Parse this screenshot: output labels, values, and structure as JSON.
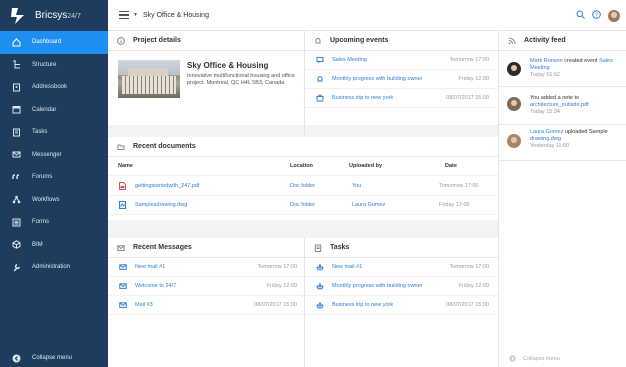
{
  "app": {
    "name": "Bricsys",
    "version": "24/7"
  },
  "breadcrumb": "Sky Office & Housing",
  "sidebar": {
    "items": [
      {
        "label": "Dashboard",
        "icon": "home-icon"
      },
      {
        "label": "Structure",
        "icon": "structure-icon"
      },
      {
        "label": "Addressbook",
        "icon": "addressbook-icon"
      },
      {
        "label": "Calendar",
        "icon": "calendar-icon"
      },
      {
        "label": "Tasks",
        "icon": "tasks-icon"
      },
      {
        "label": "Messenger",
        "icon": "envelope-icon"
      },
      {
        "label": "Forums",
        "icon": "quote-icon"
      },
      {
        "label": "Workflows",
        "icon": "workflow-icon"
      },
      {
        "label": "Forms",
        "icon": "forms-icon"
      },
      {
        "label": "BIM",
        "icon": "bim-icon"
      },
      {
        "label": "Administration",
        "icon": "wrench-icon"
      }
    ],
    "collapse": "Collapse menu"
  },
  "project": {
    "title": "Project details",
    "name": "Sky Office & Housing",
    "description": "Innovative multifunctional housing and office project. Montreal, QC H4L 5B3, Canada"
  },
  "events": {
    "title": "Upcoming events",
    "rows": [
      {
        "label": "Sales Meeting",
        "time": "Tomorrow 17:00"
      },
      {
        "label": "Monthly progress with building owner",
        "time": "Friday 12:00"
      },
      {
        "label": "Business trip to new york",
        "time": "08/07/2017 15:00"
      }
    ]
  },
  "documents": {
    "title": "Recent documents",
    "headers": [
      "Name",
      "Location",
      "Uploaded by",
      "Date"
    ],
    "rows": [
      {
        "name": "gettingstartedwith_247.pdf",
        "location": "Doc folder",
        "by": "You",
        "date": "Tomorrow 17:00"
      },
      {
        "name": "Samplesdrawing.dwg",
        "location": "Doc folder",
        "by": "Laura Gomez",
        "date": "Friday 12:00"
      }
    ]
  },
  "messages": {
    "title": "Recent Messages",
    "rows": [
      {
        "label": "New mail #1",
        "time": "Tomorrow 17:00"
      },
      {
        "label": "Welcome to 24/7",
        "time": "Friday 12:00"
      },
      {
        "label": "Mail #3",
        "time": "08/07/2017 15:00"
      }
    ]
  },
  "tasks": {
    "title": "Tasks",
    "rows": [
      {
        "label": "New mail #1",
        "time": "Tomorrow 17:00"
      },
      {
        "label": "Monthly progress with building owner",
        "time": "Friday 12:00"
      },
      {
        "label": "Business trip to new york",
        "time": "08/07/2017 15:00"
      }
    ]
  },
  "feed": {
    "title": "Activity feed",
    "items": [
      {
        "actor": "Mark Ronson",
        "action": " created event ",
        "object": "Sales Meeting",
        "time": "Today 16:52"
      },
      {
        "actor": "",
        "action": "You added a note to ",
        "object": "architecture_outside.pdf",
        "time": "Today 15:34"
      },
      {
        "actor": "Laura Gomez",
        "action": " uploaded Sample ",
        "object": "drawing.dwg",
        "time": "Yesterday 11:00"
      }
    ],
    "collapse": "Collapse menu"
  },
  "colors": {
    "sidebar": "#1d3c5e",
    "accent": "#1e8ff0",
    "link": "#2f7fd1"
  }
}
